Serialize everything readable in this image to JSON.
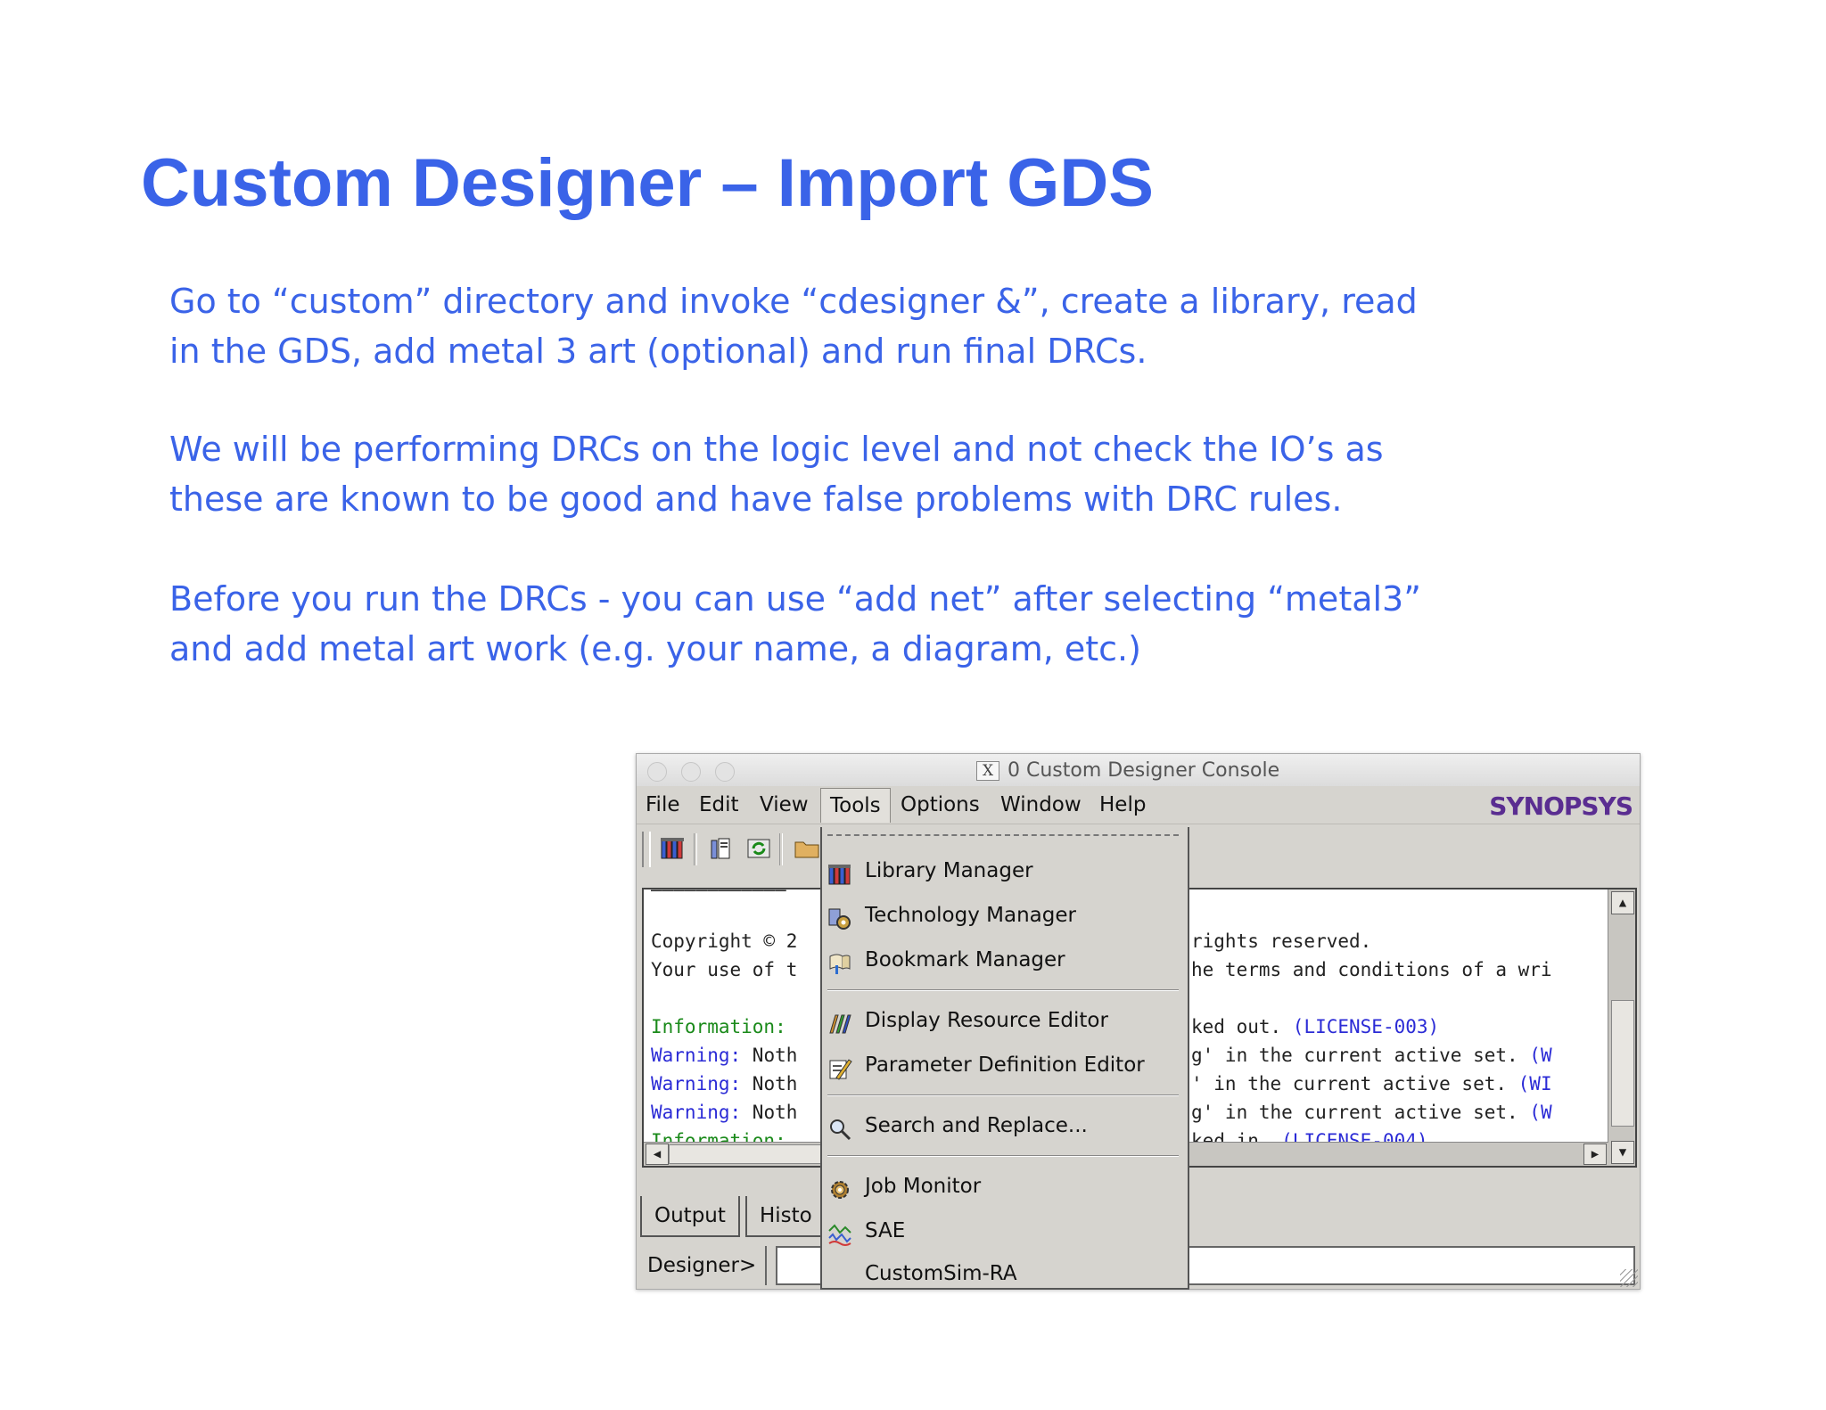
{
  "slide": {
    "title": "Custom Designer – Import GDS",
    "paragraphs": [
      "Go to “custom” directory and invoke “cdesigner &”, create a library, read\nin the GDS, add metal 3 art (optional) and run final DRCs.",
      "We will be performing DRCs on the logic level and not check the IO’s as\nthese are known to be good and have false problems with DRC rules.",
      "Before you run the DRCs - you can use “add net” after selecting “metal3”\nand add metal art work (e.g. your name, a diagram, etc.)"
    ]
  },
  "window": {
    "title": "0 Custom Designer Console",
    "x_badge": "X",
    "brand": "SYNOPSYS",
    "menu": [
      "File",
      "Edit",
      "View",
      "Tools",
      "Options",
      "Window",
      "Help"
    ],
    "active_menu": "Tools",
    "toolbar_icons": [
      "library-icon",
      "library-copy-icon",
      "refresh-icon",
      "folder-icon"
    ]
  },
  "console": {
    "lines": [
      {
        "left": "Copyright © 2",
        "right": "rights reserved.",
        "left_class": "",
        "right_class": ""
      },
      {
        "left": "Your use of t",
        "right": "he terms and conditions of a wri",
        "left_class": "",
        "right_class": ""
      },
      {
        "left": "Information:",
        "right": "ked out. ",
        "right_extra": "(LICENSE-003)",
        "left_class": "green"
      },
      {
        "left": "Warning:",
        "left_rest": " Noth",
        "right": "g' in the current active set. ",
        "right_extra": "(W",
        "left_class": "blue"
      },
      {
        "left": "Warning:",
        "left_rest": " Noth",
        "right": "' in the current active set. ",
        "right_extra": "(WI",
        "left_class": "blue"
      },
      {
        "left": "Warning:",
        "left_rest": " Noth",
        "right": "g' in the current active set. ",
        "right_extra": "(W",
        "left_class": "blue"
      },
      {
        "left": "Information:",
        "right": "ked in. ",
        "right_extra": "(LICENSE-004)",
        "left_class": "green"
      }
    ]
  },
  "tabs": [
    "Output",
    "Histo"
  ],
  "prompt": "Designer>",
  "tools_menu": {
    "items": [
      {
        "label": "Library Manager",
        "icon": "library-icon"
      },
      {
        "label": "Technology Manager",
        "icon": "technology-gear-icon"
      },
      {
        "label": "Bookmark Manager",
        "icon": "bookmark-icon"
      },
      {
        "label": "Display Resource Editor",
        "icon": "display-resource-icon"
      },
      {
        "label": "Parameter Definition Editor",
        "icon": "parameter-edit-icon"
      },
      {
        "label": "Search and Replace...",
        "icon": "magnifier-icon"
      },
      {
        "label": "Job Monitor",
        "icon": "gear-icon"
      },
      {
        "label": "SAE",
        "icon": "sae-waveform-icon"
      },
      {
        "label": "CustomSim-RA",
        "icon": ""
      }
    ]
  }
}
